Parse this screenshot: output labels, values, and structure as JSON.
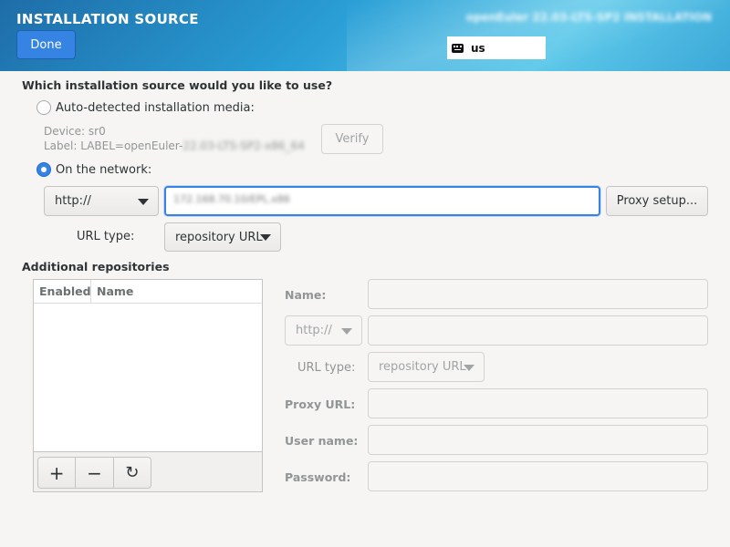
{
  "header": {
    "title": "INSTALLATION SOURCE",
    "product": "openEuler 22.03-LTS-SP2 INSTALLATION",
    "done_label": "Done",
    "keyboard_layout": "us",
    "accent": "#3584e4"
  },
  "source": {
    "question": "Which installation source would you like to use?",
    "auto_label": "Auto-detected installation media:",
    "device_line": "Device: sr0",
    "label_prefix": "Label: LABEL=openEuler-",
    "label_blurred": "22.03-LTS-SP2-x86_64",
    "verify_label": "Verify",
    "network_label": "On the network:",
    "protocol": "http://",
    "url_value": "172.168.70.10/EPL.x86",
    "proxy_label": "Proxy setup...",
    "url_type_label": "URL type:",
    "url_type_value": "repository URL"
  },
  "additional": {
    "heading": "Additional repositories",
    "columns": [
      "Enabled",
      "Name"
    ],
    "add_icon": "+",
    "remove_icon": "−",
    "refresh_icon": "↻",
    "name_label": "Name:",
    "protocol": "http://",
    "url_type_label": "URL type:",
    "url_type_value": "repository URL",
    "proxy_url_label": "Proxy URL:",
    "username_label": "User name:",
    "password_label": "Password:"
  }
}
